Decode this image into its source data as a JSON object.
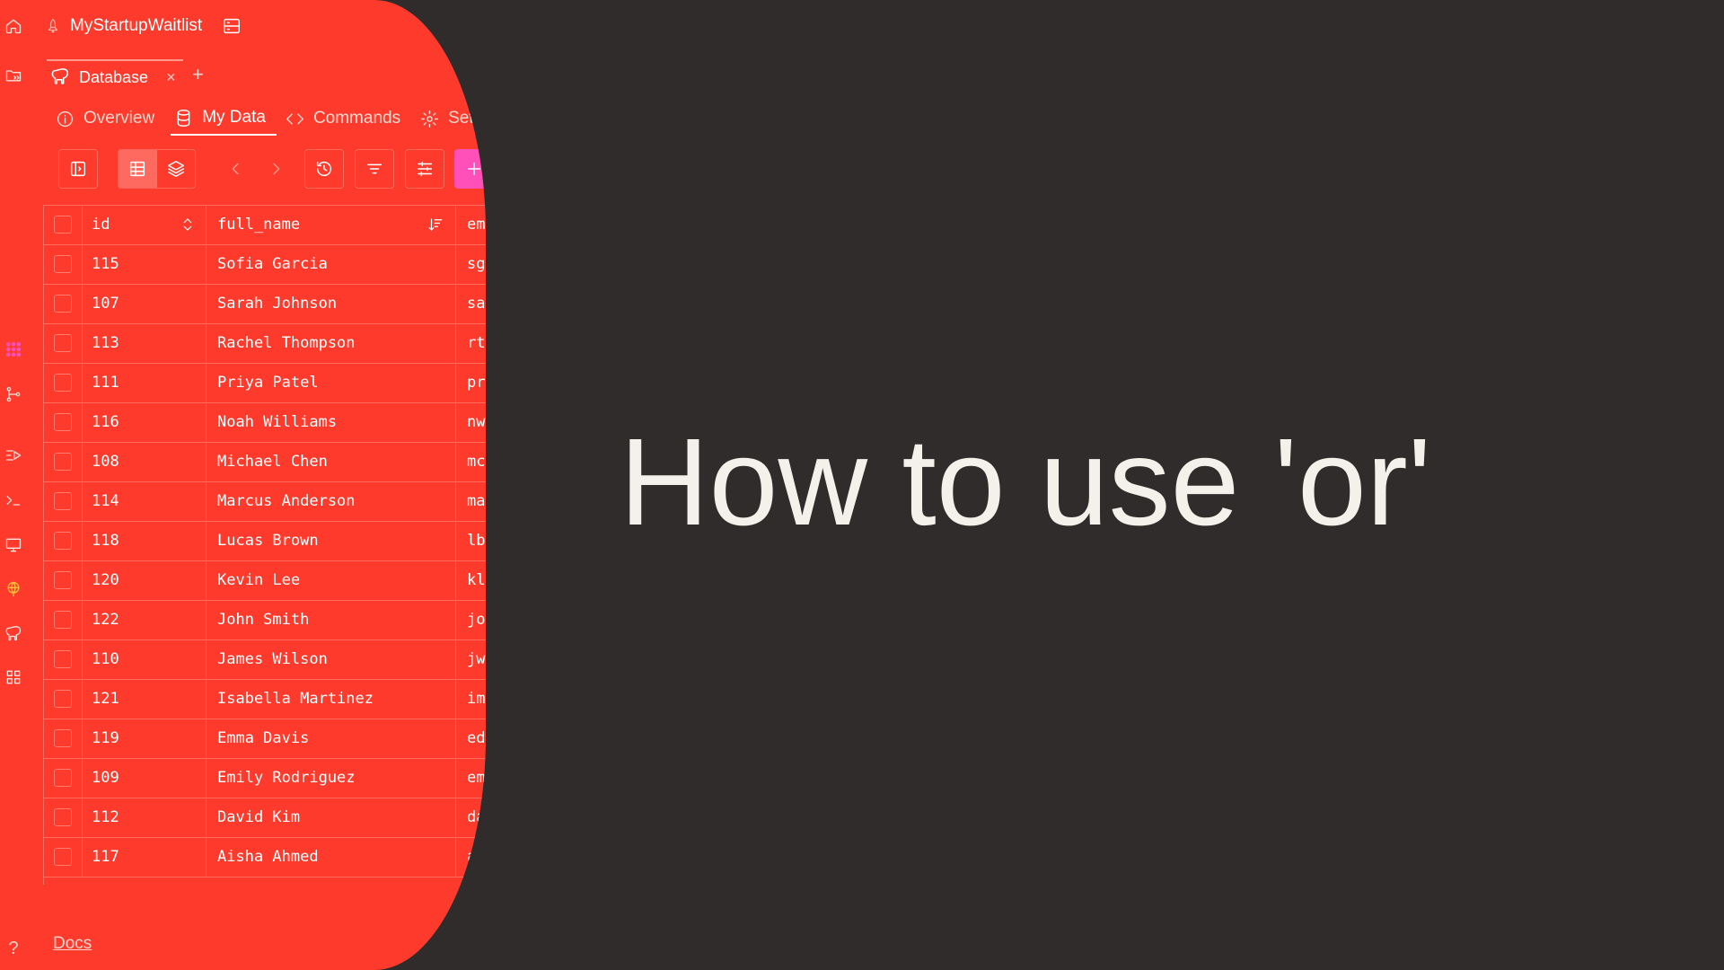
{
  "app": {
    "title": "MyStartupWaitlist",
    "tab_label": "Database",
    "tab_close": "×",
    "new_tab": "+",
    "docs_link": "Docs",
    "help": "?"
  },
  "subtabs": [
    {
      "label": "Overview",
      "icon": "info-icon",
      "active": false
    },
    {
      "label": "My Data",
      "icon": "database-icon",
      "active": true
    },
    {
      "label": "Commands",
      "icon": "code-icon",
      "active": false
    },
    {
      "label": "Settings",
      "icon": "gear-icon",
      "active": false
    }
  ],
  "table": {
    "columns": [
      "id",
      "full_name",
      "email"
    ],
    "rows": [
      {
        "id": "115",
        "full_name": "Sofia Garcia",
        "email": "sg"
      },
      {
        "id": "107",
        "full_name": "Sarah Johnson",
        "email": "sa"
      },
      {
        "id": "113",
        "full_name": "Rachel Thompson",
        "email": "rt"
      },
      {
        "id": "111",
        "full_name": "Priya Patel",
        "email": "pr"
      },
      {
        "id": "116",
        "full_name": "Noah Williams",
        "email": "nw"
      },
      {
        "id": "108",
        "full_name": "Michael Chen",
        "email": "mc"
      },
      {
        "id": "114",
        "full_name": "Marcus Anderson",
        "email": "ma"
      },
      {
        "id": "118",
        "full_name": "Lucas Brown",
        "email": "lb"
      },
      {
        "id": "120",
        "full_name": "Kevin Lee",
        "email": "kl"
      },
      {
        "id": "122",
        "full_name": "John Smith",
        "email": "jo"
      },
      {
        "id": "110",
        "full_name": "James Wilson",
        "email": "jw"
      },
      {
        "id": "121",
        "full_name": "Isabella Martinez",
        "email": "im"
      },
      {
        "id": "119",
        "full_name": "Emma Davis",
        "email": "ed"
      },
      {
        "id": "109",
        "full_name": "Emily Rodriguez",
        "email": "em"
      },
      {
        "id": "112",
        "full_name": "David Kim",
        "email": "da"
      },
      {
        "id": "117",
        "full_name": "Aisha Ahmed",
        "email": "a."
      }
    ]
  },
  "headline": "How to use 'or'",
  "colors": {
    "panel": "#fd3a2b",
    "background": "#302c2c",
    "headline": "#f4f1ea",
    "accent_pink": "#ff4fb8"
  }
}
